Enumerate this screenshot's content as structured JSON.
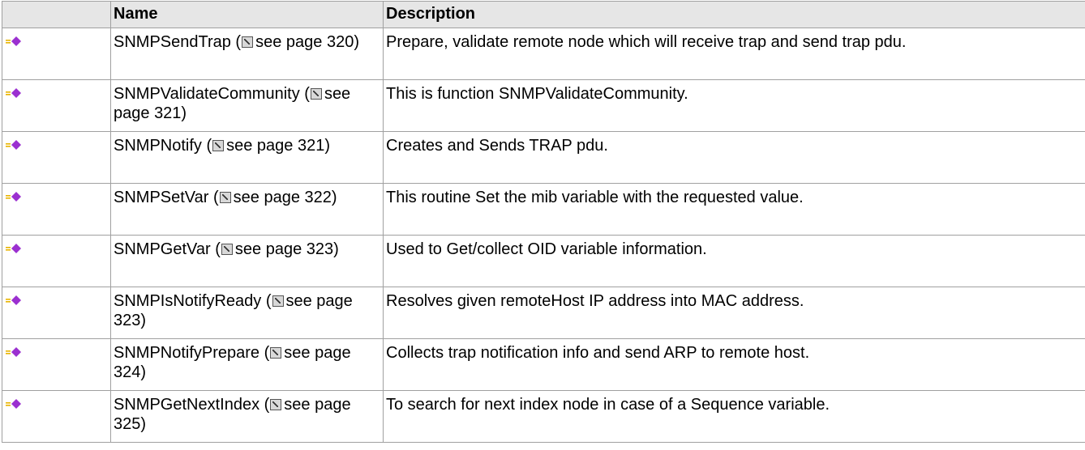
{
  "header": {
    "icon_col": "",
    "name": "Name",
    "description": "Description"
  },
  "link_text": "see page",
  "rows": [
    {
      "name": "SNMPSendTrap",
      "page": "320)",
      "description": "Prepare, validate remote node which will receive trap and send trap pdu."
    },
    {
      "name": "SNMPValidateCommunity",
      "page": "321)",
      "description": "This is function SNMPValidateCommunity."
    },
    {
      "name": "SNMPNotify",
      "page": "321)",
      "description": "Creates and Sends TRAP pdu."
    },
    {
      "name": "SNMPSetVar",
      "page": "322)",
      "description": "This routine Set the mib variable with the requested value."
    },
    {
      "name": "SNMPGetVar",
      "page": "323)",
      "description": "Used to Get/collect OID variable information."
    },
    {
      "name": "SNMPIsNotifyReady",
      "page": "323)",
      "description": "Resolves given remoteHost IP address into MAC address."
    },
    {
      "name": "SNMPNotifyPrepare",
      "page": "324)",
      "description": "Collects trap notification info and send ARP to remote host."
    },
    {
      "name": "SNMPGetNextIndex",
      "page": "325)",
      "description": "To search for next index node in case of a Sequence variable."
    }
  ],
  "colors": {
    "header_bg": "#e6e6e6",
    "border": "#a0a0a0",
    "icon_purple": "#9b30d0",
    "icon_gold": "#e8b400"
  },
  "icons": {
    "row_icon": "public-method-icon",
    "link_icon": "external-link-icon"
  }
}
